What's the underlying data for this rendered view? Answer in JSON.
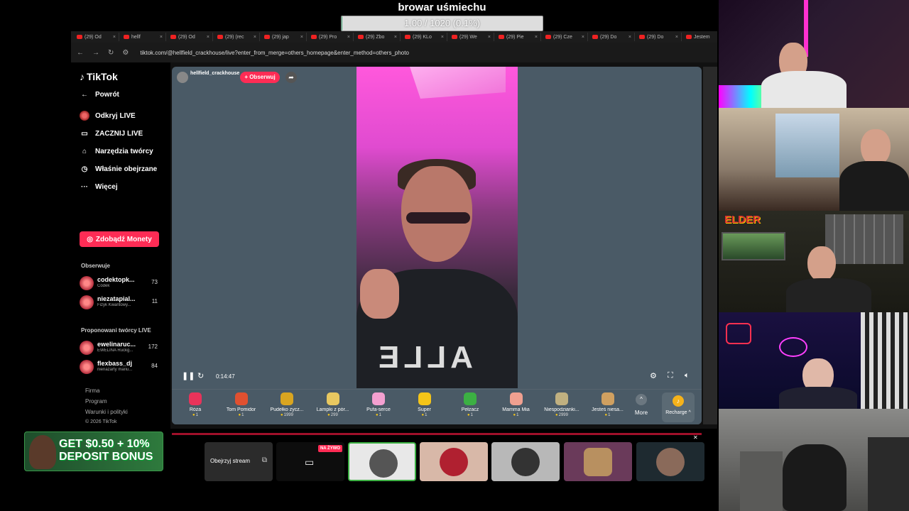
{
  "overlay": {
    "title": "browar uśmiechu",
    "progress_text": "1.00 / 1020 (0.1%)",
    "progress_fraction": 0.001
  },
  "browser": {
    "tabs": [
      "(29) Od",
      "hellf",
      "(29) Od",
      "(29) (rec",
      "(29) jap",
      "(29) Pro",
      "(29) Zbo",
      "(29) KLo",
      "(29) We",
      "(29) Pie",
      "(29) Cze",
      "(29) Do",
      "(29) Do",
      "Jestem"
    ],
    "url": "tiktok.com/@hellfield_crackhouse/live?enter_from_merge=others_homepage&enter_method=others_photo"
  },
  "sidebar": {
    "logo": "TikTok",
    "back": "Powrót",
    "nav": [
      {
        "label": "Odkryj LIVE",
        "icon": "live-avatar-icon"
      },
      {
        "label": "ZACZNIJ LIVE",
        "icon": "camera-icon"
      },
      {
        "label": "Narzędzia twórcy",
        "icon": "home-icon"
      },
      {
        "label": "Właśnie obejrzane",
        "icon": "history-icon"
      },
      {
        "label": "Więcej",
        "icon": "more-icon"
      }
    ],
    "coins_button": "Zdobądź Monety",
    "following_title": "Obserwuje",
    "following": [
      {
        "name": "codektopk...",
        "sub": "Codek",
        "count": "73"
      },
      {
        "name": "niezatapial...",
        "sub": "Fizyk Kwantowy...",
        "count": "11"
      }
    ],
    "suggested_title": "Proponowani twórcy LIVE",
    "suggested": [
      {
        "name": "ewelinaruc...",
        "sub": "EWELINA Ruckg...",
        "count": "172"
      },
      {
        "name": "flexbass_dj",
        "sub": "nienażarty mariu...",
        "count": "84"
      }
    ],
    "footer": [
      "Firma",
      "Program",
      "Warunki i polityki",
      "© 2026 TikTok"
    ]
  },
  "player": {
    "host_name": "hellfield_crackhouse",
    "follow_label": "+ Obserwuj",
    "time": "0:14:47",
    "gifts": [
      {
        "name": "Róża",
        "price": "1",
        "color": "#e8335a"
      },
      {
        "name": "Tom Pomidor",
        "price": "1",
        "color": "#e05030"
      },
      {
        "name": "Pudełko życz...",
        "price": "1999",
        "color": "#d9a520"
      },
      {
        "name": "Lampki z pór...",
        "price": "299",
        "color": "#e8c860"
      },
      {
        "name": "Pufa-serce",
        "price": "1",
        "color": "#f4a0d0"
      },
      {
        "name": "Super",
        "price": "1",
        "color": "#f5c518"
      },
      {
        "name": "Pełzacz",
        "price": "1",
        "color": "#3cb043"
      },
      {
        "name": "Mamma Mia",
        "price": "1",
        "color": "#f0a090"
      },
      {
        "name": "Niespodzianki...",
        "price": "2999",
        "color": "#c0b080"
      },
      {
        "name": "Jesteś niesa...",
        "price": "1",
        "color": "#d0a060"
      }
    ],
    "more_label": "More",
    "recharge_label": "Recharge ^"
  },
  "bottom": {
    "banner_text": "GET $0.50 + 10% DEPOSIT BONUS",
    "watch_label": "Obejrzyj stream",
    "live_badge": "NA ŻYWO"
  },
  "cams": {
    "elder_logo": "ELDER"
  }
}
